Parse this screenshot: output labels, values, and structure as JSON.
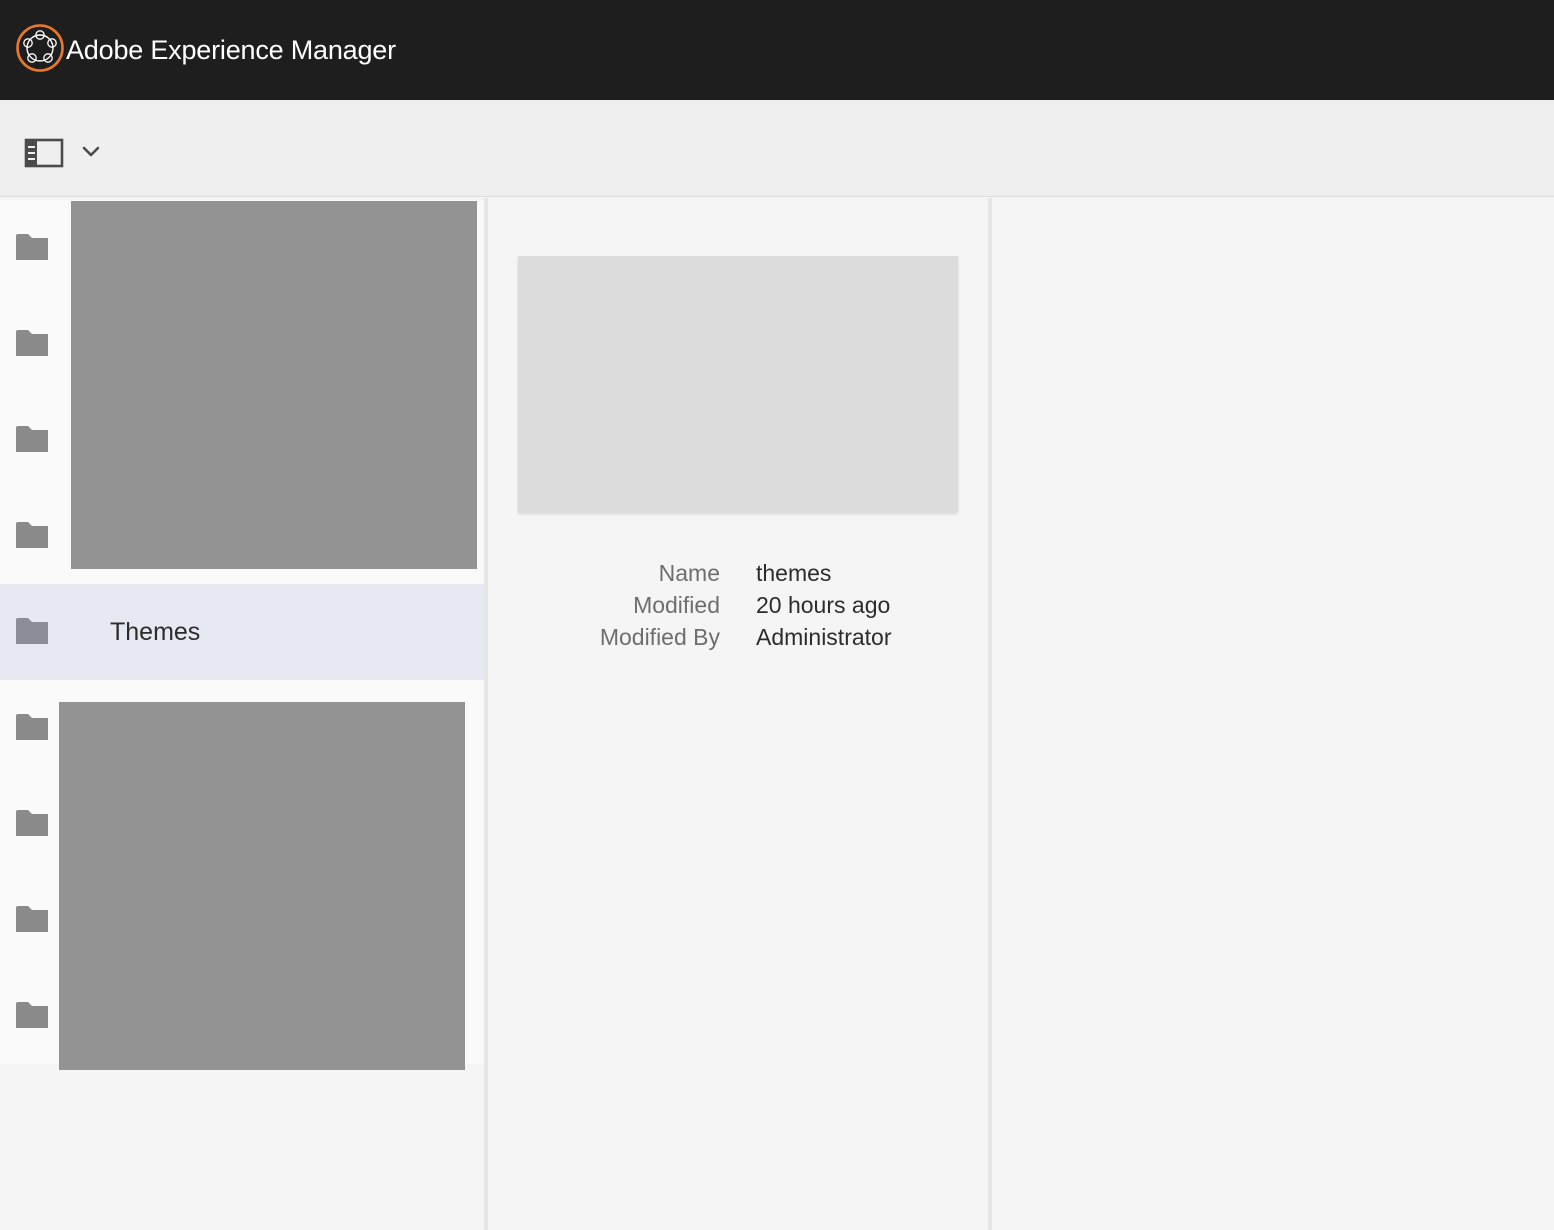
{
  "app": {
    "title": "Adobe Experience Manager"
  },
  "toolbar": {
    "rail_icon": "rail-toggle-icon",
    "dropdown_icon": "chevron-down-icon"
  },
  "column1": {
    "items": [
      {
        "label": "",
        "icon": "folder-icon"
      },
      {
        "label": "",
        "icon": "folder-icon"
      },
      {
        "label": "",
        "icon": "folder-icon"
      },
      {
        "label": "",
        "icon": "folder-icon"
      },
      {
        "label": "Themes",
        "icon": "folder-icon",
        "selected": true
      },
      {
        "label": "",
        "icon": "folder-icon"
      },
      {
        "label": "",
        "icon": "folder-icon"
      },
      {
        "label": "",
        "icon": "folder-icon"
      },
      {
        "label": "",
        "icon": "folder-icon"
      }
    ]
  },
  "details": {
    "fields": [
      {
        "key": "Name",
        "value": "themes"
      },
      {
        "key": "Modified",
        "value": "20 hours ago"
      },
      {
        "key": "Modified By",
        "value": "Administrator"
      }
    ]
  },
  "colors": {
    "topbar": "#1e1e1e",
    "logo_accent": "#e9782d",
    "selected_row": "#e6e9f1"
  }
}
